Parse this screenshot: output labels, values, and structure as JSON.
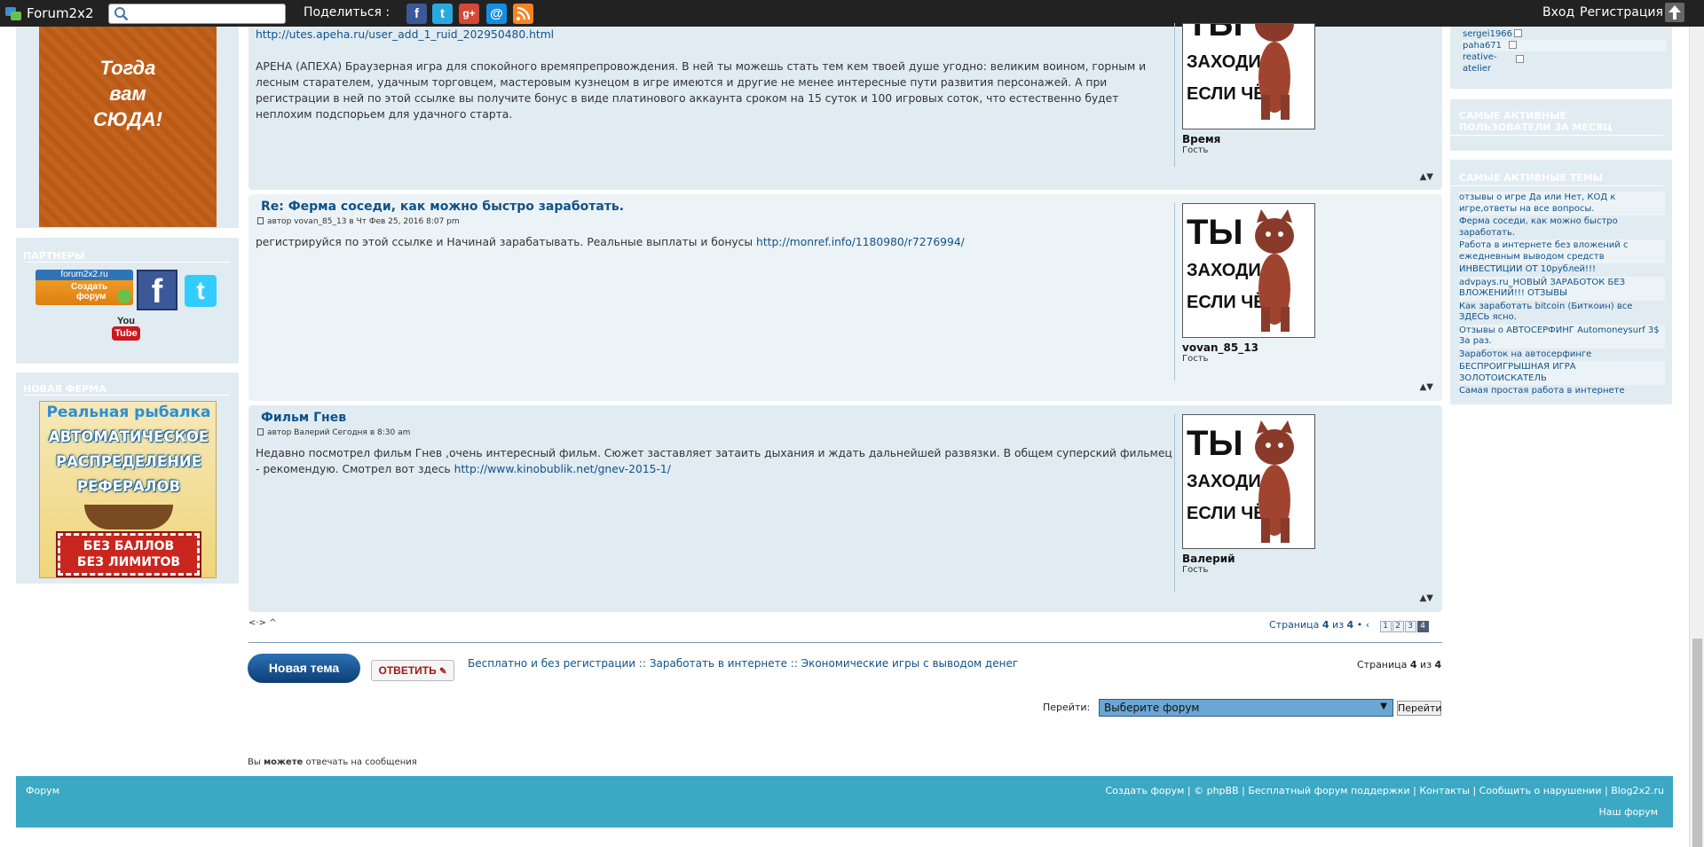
{
  "topbar": {
    "brand": "Forum2x2",
    "search_placeholder": "",
    "share_label": "Поделиться :",
    "share_icons": [
      "facebook-icon",
      "twitter-icon",
      "google-plus-icon",
      "email-icon",
      "rss-icon"
    ],
    "login": "Вход",
    "register": "Регистрация"
  },
  "left_sidebar": {
    "ad1_text": [
      "Тогда",
      "вам",
      "СЮДА!"
    ],
    "partners_title": "ПАРТНЕРЫ",
    "partner_logo": {
      "line1": "forum2x2.ru",
      "line2": "Создать",
      "line3": "форум"
    },
    "youtube": {
      "top": "You",
      "bottom": "Tube"
    },
    "new_farm_title": "НОВАЯ ФЕРМА",
    "banner": {
      "line1": "Реальная рыбалка",
      "line2": "АВТОМАТИЧЕСКОЕ",
      "line3": "РАСПРЕДЕЛЕНИЕ",
      "line4": "РЕФЕРАЛОВ",
      "line5": "БЕЗ БАЛЛОВ",
      "line6": "БЕЗ ЛИМИТОВ"
    }
  },
  "posts": [
    {
      "link": "http://utes.apeha.ru/user_add_1_ruid_202950480.html",
      "body": "АРЕНА (АПЕХА) Браузерная игра для спокойного времяпрепровождения. В ней ты можешь стать тем кем твоей душе угодно: великим воином, горным и лесным старателем, удачным торговцем, мастеровым кузнецом в игре имеются и другие не менее интересные пути развития персонажей. А при регистрации в ней по этой ссылке вы получите бонус в виде платинового аккаунта сроком на 15 суток и 100 игровых соток, что естественно будет неплохим подспорьем для удачного старта.",
      "username": "Время",
      "rank": "Гость"
    },
    {
      "title": "Re: Ферма соседи, как можно быстро заработать.",
      "author_line": "автор vovan_85_13 в Чт Фев 25, 2016 8:07 pm",
      "body": "регистрируйся по этой ссылке и Начинай зарабатывать. Реальные выплаты и бонусы ",
      "link": "http://monref.info/1180980/r7276994/",
      "username": "vovan_85_13",
      "rank": "Гость"
    },
    {
      "title": "Фильм Гнев",
      "author_line": "автор Валерий Сегодня в 8:30 am",
      "body": "Недавно посмотрел фильм Гнев ,очень интересный фильм. Сюжет заставляет затаить дыхания и ждать дальнейшей развязки. В общем суперский фильмец - рекомендую. Смотрел вот здесь ",
      "link": "http://www.kinobublik.net/gnev-2015-1/",
      "username": "Валерий",
      "rank": "Гость"
    }
  ],
  "avatar_text": {
    "l1": "ТЫ",
    "l2": "ЗАХОДИ,",
    "l3": "ЕСЛИ ЧЁ"
  },
  "post_nav": "▲▼",
  "pagination": {
    "arrows": "<·> ^",
    "label": "Страница",
    "current": "4",
    "of": "из",
    "total": "4",
    "pages": [
      "1",
      "2",
      "3",
      "4"
    ]
  },
  "actions": {
    "new_topic": "Новая тема",
    "reply": "ОТВЕТИТЬ",
    "breadcrumb": [
      "Бесплатно и без регистрации",
      "Заработать в интернете",
      "Экономические игры с выводом денег"
    ],
    "breadcrumb_sep": "::"
  },
  "jump": {
    "label": "Перейти:",
    "selected": "Выберите форум",
    "button": "Перейти"
  },
  "permissions": {
    "pre": "Вы ",
    "bold": "можете",
    "post": " отвечать на сообщения"
  },
  "right_sidebar": {
    "users": [
      {
        "name": "sergei1966"
      },
      {
        "name": "paha671"
      },
      {
        "name": "reative-atelier"
      }
    ],
    "active_users_title": "САМЫЕ АКТИВНЫЕ ПОЛЬЗОВАТЕЛИ ЗА МЕСЯЦ",
    "active_topics_title": "САМЫЕ АКТИВНЫЕ ТЕМЫ",
    "topics": [
      "отзывы о игре Да или Нет, КОД к игре,ответы на все вопросы.",
      "Ферма соседи, как можно быстро заработать.",
      "Работа в интернете без вложений с ежедневным выводом средств",
      "ИНВЕСТИЦИИ ОТ 10рублей!!!",
      "advpays.ru_НОВЫЙ ЗАРАБОТОК БЕЗ ВЛОЖЕНИЙ!!! ОТЗЫВЫ",
      "Как заработать bitcoin (Биткоин) все ЗДЕСЬ ясно.",
      "Отзывы о АВТОСЕРФИНГ Automoneysurf 3$ За раз.",
      "Заработок на автосерфинге",
      "БЕСПРОИГРЫШНАЯ ИГРА ЗОЛОТОИСКАТЕЛЬ",
      "Самая простая работа в интернете"
    ]
  },
  "footer": {
    "left": "Форум",
    "links": [
      "Создать форум",
      "© phpBB",
      "Бесплатный форум поддержки",
      "Контакты",
      "Сообщить о нарушении",
      "Blog2x2.ru"
    ],
    "second_row": "Наш форум"
  }
}
